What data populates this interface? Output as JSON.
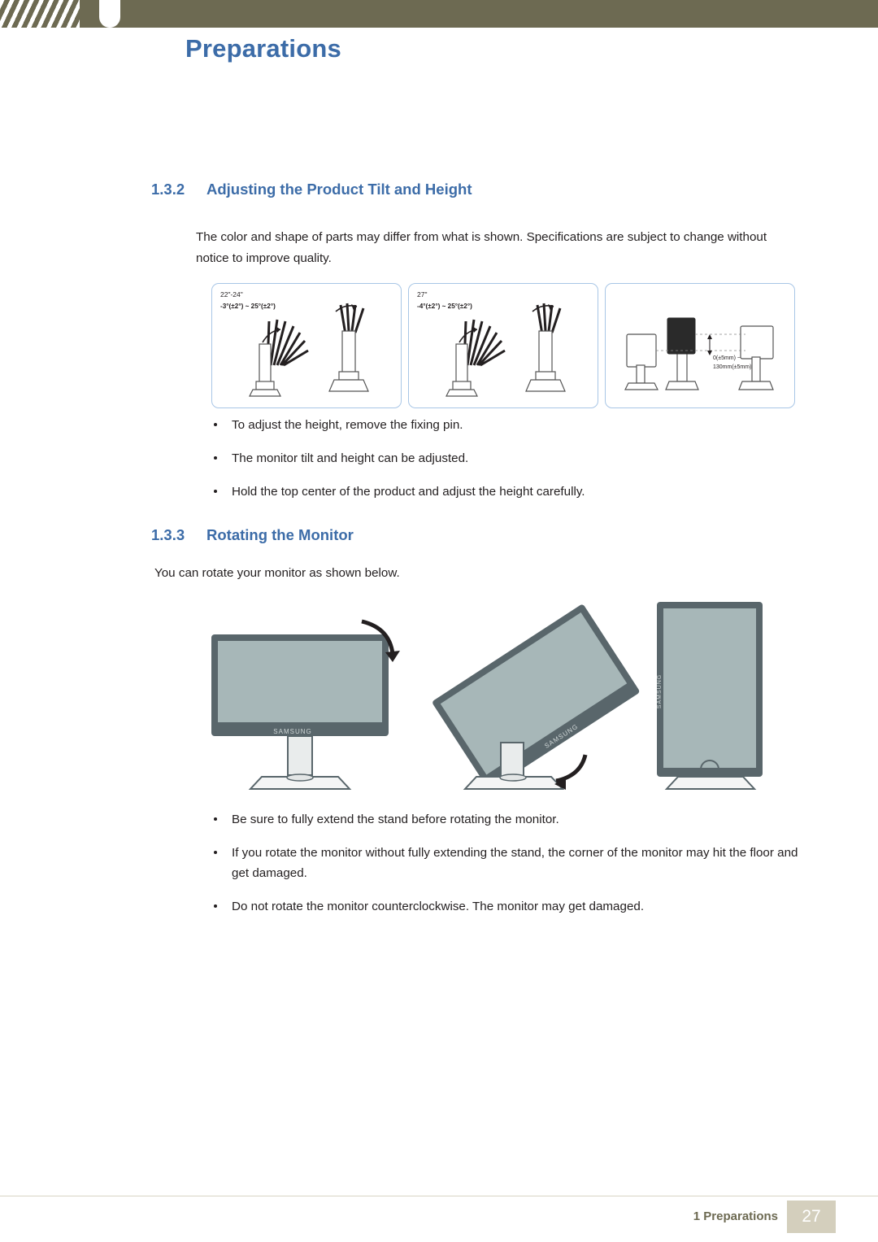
{
  "header": {
    "title": "Preparations"
  },
  "sections": [
    {
      "number": "1.3.2",
      "title": "Adjusting the Product Tilt and Height",
      "intro": "The color and shape of parts may differ from what is shown. Specifications are subject to change without notice to improve quality.",
      "figures": [
        {
          "size_label": "22\"-24\"",
          "angle_label": "-3°(±2°) ~ 25°(±2°)"
        },
        {
          "size_label": "27\"",
          "angle_label": "-4°(±2°) ~ 25°(±2°)"
        },
        {
          "height_label_line1": "0(±5mm) ~",
          "height_label_line2": "130mm(±5mm)"
        }
      ],
      "bullets": [
        "To adjust the height, remove the fixing pin.",
        "The monitor tilt and height can be adjusted.",
        "Hold the top center of the product and adjust the height carefully."
      ]
    },
    {
      "number": "1.3.3",
      "title": "Rotating the Monitor",
      "intro": "You can rotate your monitor as shown below.",
      "brand_mark": "SAMSUNG",
      "bullets": [
        "Be sure to fully extend the stand before rotating the monitor.",
        "If you rotate the monitor without fully extending the stand, the corner of the monitor may hit the floor and get damaged.",
        "Do not rotate the monitor counterclockwise. The monitor may get damaged."
      ]
    }
  ],
  "footer": {
    "chapter": "1 Preparations",
    "page": "27"
  },
  "colors": {
    "heading_blue": "#3c6ca8",
    "header_band": "#6d6a52",
    "page_box": "#d4cfbd",
    "figure_border": "#a8c6e6"
  }
}
